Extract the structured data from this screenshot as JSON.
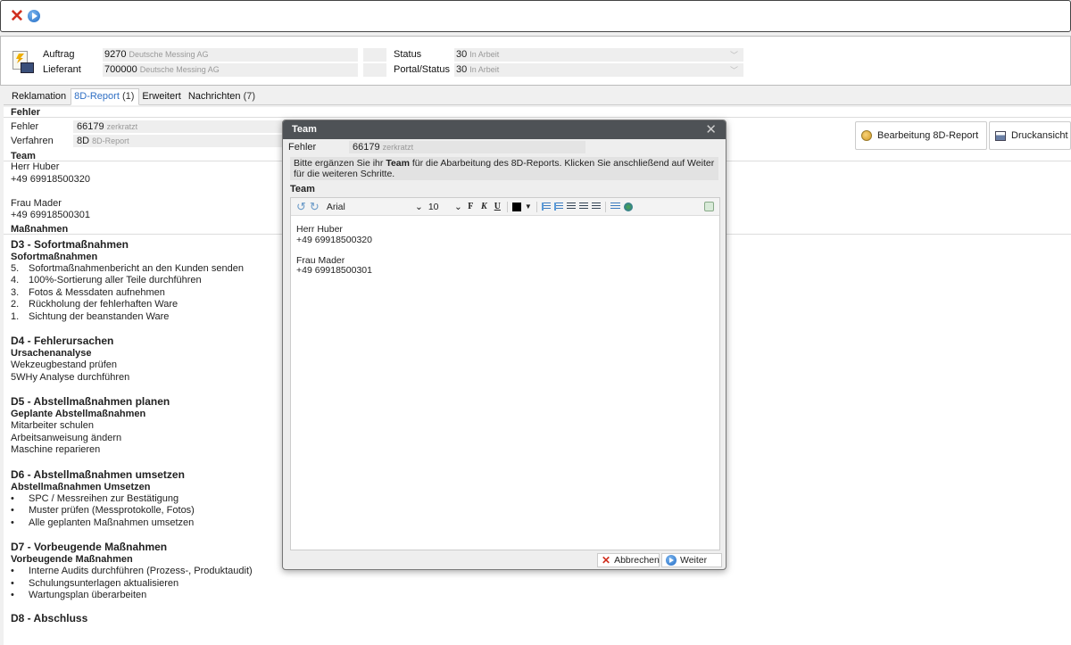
{
  "topbar": {
    "close_icon": "close-icon",
    "next_icon": "play-icon"
  },
  "header": {
    "auftrag_label": "Auftrag",
    "auftrag_code": "9270",
    "auftrag_desc": "Deutsche Messing AG",
    "lieferant_label": "Lieferant",
    "lieferant_code": "700000",
    "lieferant_desc": "Deutsche Messing AG",
    "status_label": "Status",
    "status_code": "30",
    "status_desc": "In Arbeit",
    "portal_label": "Portal/Status",
    "portal_code": "30",
    "portal_desc": "In Arbeit"
  },
  "tabs": [
    {
      "label": "Reklamation",
      "count": ""
    },
    {
      "label": "8D-Report",
      "count": "(1)"
    },
    {
      "label": "Erweitert",
      "count": ""
    },
    {
      "label": "Nachrichten",
      "count": "(7)"
    }
  ],
  "left": {
    "fehler_section": "Fehler",
    "fehler_label": "Fehler",
    "fehler_code": "66179",
    "fehler_desc": "zerkratzt",
    "verfahren_label": "Verfahren",
    "verfahren_code": "8D",
    "verfahren_desc": "8D-Report",
    "team_section": "Team",
    "team_lines": [
      "Herr Huber",
      "+49 69918500320",
      "",
      "Frau Mader",
      "+49 69918500301"
    ],
    "massnahmen_section": "Maßnahmen"
  },
  "measures": {
    "d3_title": "D3 - Sofortmaßnahmen",
    "d3_sub": "Sofortmaßnahmen",
    "d3_items": [
      {
        "n": "5.",
        "t": "Sofortmaßnahmenbericht an den Kunden senden"
      },
      {
        "n": "4.",
        "t": "100%-Sortierung aller Teile durchführen"
      },
      {
        "n": "3.",
        "t": "Fotos & Messdaten aufnehmen"
      },
      {
        "n": "2.",
        "t": "Rückholung der fehlerhaften Ware"
      },
      {
        "n": "1.",
        "t": "Sichtung der beanstanden Ware"
      }
    ],
    "d4_title": "D4 - Fehlerursachen",
    "d4_sub": "Ursachenanalyse",
    "d4_items": [
      "Wekzeugbestand prüfen",
      "5WHy Analyse durchführen"
    ],
    "d5_title": "D5 - Abstellmaßnahmen planen",
    "d5_sub": "Geplante Abstellmaßnahmen",
    "d5_items": [
      "Mitarbeiter schulen",
      "Arbeitsanweisung ändern",
      "Maschine reparieren"
    ],
    "d6_title": "D6 - Abstellmaßnahmen umsetzen",
    "d6_sub": "Abstellmaßnahmen Umsetzen",
    "d6_items": [
      "SPC / Messreihen zur Bestätigung",
      "Muster prüfen (Messprotokolle, Fotos)",
      "Alle geplanten Maßnahmen umsetzen"
    ],
    "d7_title": "D7 - Vorbeugende Maßnahmen",
    "d7_sub": "Vorbeugende Maßnahmen",
    "d7_items": [
      "Interne Audits durchführen (Prozess-, Produktaudit)",
      "Schulungsunterlagen aktualisieren",
      "Wartungsplan überarbeiten"
    ],
    "d8_title": "D8 - Abschluss",
    "bullet": "•"
  },
  "actions": {
    "edit_label": "Bearbeitung 8D-Report",
    "print_label": "Druckansicht"
  },
  "modal": {
    "title": "Team",
    "close": "✕",
    "fehler_label": "Fehler",
    "fehler_code": "66179",
    "fehler_desc": "zerkratzt",
    "info_pre": "Bitte ergänzen Sie ihr ",
    "info_bold": "Team",
    "info_post": " für die Abarbeitung des 8D-Reports. Klicken Sie anschließend auf Weiter für die weiteren Schritte.",
    "team_label": "Team",
    "font": "Arial",
    "font_size": "10",
    "editor_lines": [
      "Herr Huber",
      "+49 69918500320",
      "",
      "Frau Mader",
      "+49 69918500301"
    ],
    "cancel_label": "Abbrechen",
    "next_label": "Weiter"
  }
}
